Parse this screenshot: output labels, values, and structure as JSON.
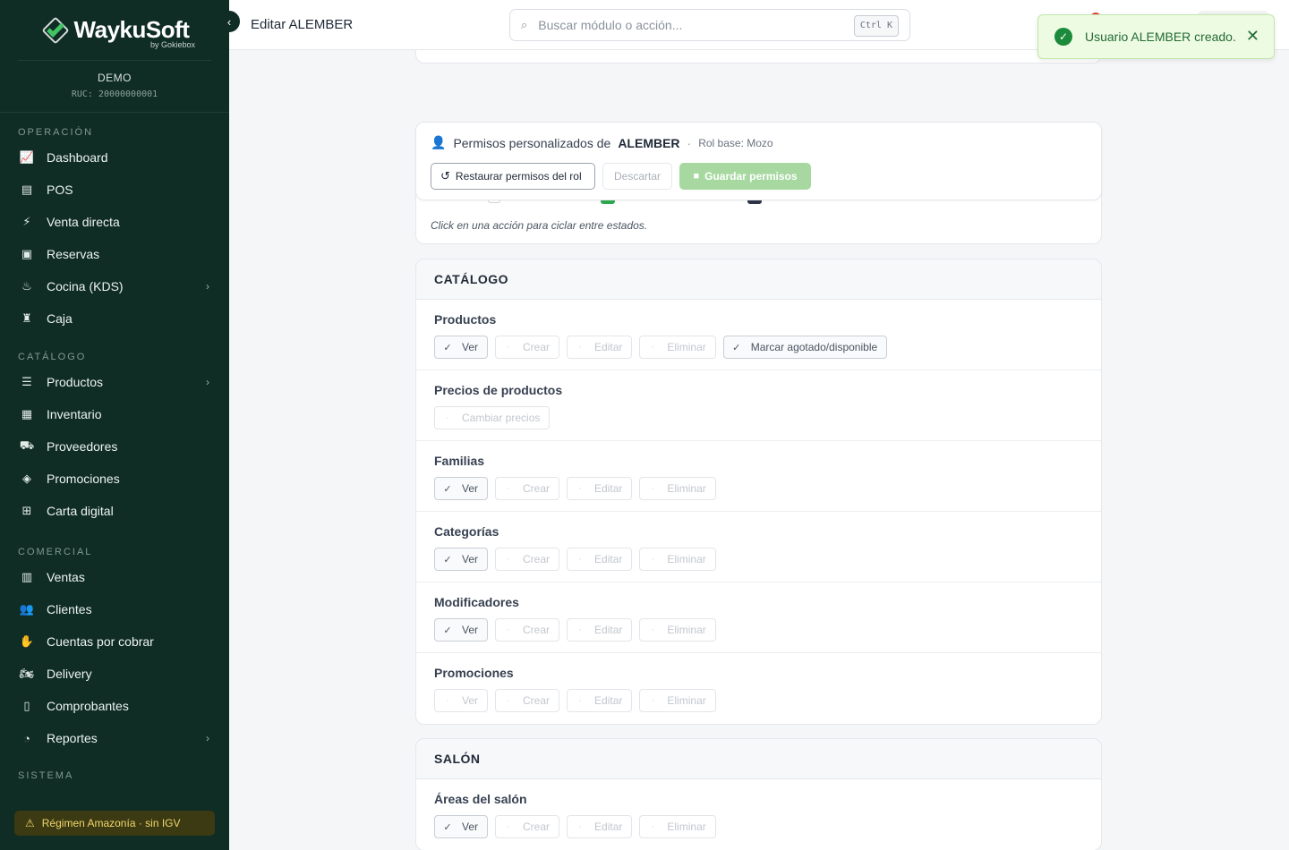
{
  "brand": {
    "name": "WaykuSoft",
    "sub": "by Gokiebox"
  },
  "company": {
    "name": "DEMO",
    "ruc": "RUC: 20000000001"
  },
  "sidebar": {
    "sections": [
      {
        "label": "OPERACIÓN",
        "items": [
          {
            "label": "Dashboard",
            "icon": "chart-line-icon",
            "glyph": "📈"
          },
          {
            "label": "POS",
            "icon": "register-icon",
            "glyph": "▤"
          },
          {
            "label": "Venta directa",
            "icon": "bolt-icon",
            "glyph": "⚡"
          },
          {
            "label": "Reservas",
            "icon": "calendar-check-icon",
            "glyph": "▣"
          },
          {
            "label": "Cocina (KDS)",
            "icon": "kitchen-icon",
            "glyph": "♨",
            "chevron": true
          },
          {
            "label": "Caja",
            "icon": "money-bag-icon",
            "glyph": "♜"
          }
        ]
      },
      {
        "label": "CATÁLOGO",
        "items": [
          {
            "label": "Productos",
            "icon": "burger-icon",
            "glyph": "☰",
            "chevron": true
          },
          {
            "label": "Inventario",
            "icon": "boxes-icon",
            "glyph": "▦"
          },
          {
            "label": "Proveedores",
            "icon": "truck-icon",
            "glyph": "⛟"
          },
          {
            "label": "Promociones",
            "icon": "tags-icon",
            "glyph": "◈"
          },
          {
            "label": "Carta digital",
            "icon": "qr-code-icon",
            "glyph": "⊞"
          }
        ]
      },
      {
        "label": "COMERCIAL",
        "items": [
          {
            "label": "Ventas",
            "icon": "receipt-icon",
            "glyph": "▥"
          },
          {
            "label": "Clientes",
            "icon": "users-icon",
            "glyph": "👥"
          },
          {
            "label": "Cuentas por cobrar",
            "icon": "hand-coin-icon",
            "glyph": "✋"
          },
          {
            "label": "Delivery",
            "icon": "motorcycle-icon",
            "glyph": "🏍"
          },
          {
            "label": "Comprobantes",
            "icon": "file-icon",
            "glyph": "▯"
          },
          {
            "label": "Reportes",
            "icon": "pie-chart-icon",
            "glyph": "◔",
            "chevron": true
          }
        ]
      },
      {
        "label": "SISTEMA",
        "items": []
      }
    ],
    "regime": "Régimen Amazonía · sin IGV"
  },
  "topbar": {
    "title": "Editar ALEMBER",
    "search_placeholder": "Buscar módulo o acción...",
    "shortcut": "Ctrl K"
  },
  "toast": {
    "message": "Usuario ALEMBER creado.",
    "close": "✕"
  },
  "permissions": {
    "title_prefix": "Permisos personalizados de",
    "user": "ALEMBER",
    "role": "Rol base: Mozo",
    "restore_label": "Restaurar permisos del rol",
    "discard_label": "Descartar",
    "save_label": "Guardar permisos",
    "hint": "Click en una acción para ciclar entre estados."
  },
  "sections": [
    {
      "title": "CATÁLOGO",
      "rows": [
        {
          "name": "Productos",
          "actions": [
            {
              "label": "Ver",
              "on": true
            },
            {
              "label": "Crear",
              "on": false
            },
            {
              "label": "Editar",
              "on": false
            },
            {
              "label": "Eliminar",
              "on": false
            },
            {
              "label": "Marcar agotado/disponible",
              "on": true
            }
          ]
        },
        {
          "name": "Precios de productos",
          "actions": [
            {
              "label": "Cambiar precios",
              "on": false
            }
          ]
        },
        {
          "name": "Familias",
          "actions": [
            {
              "label": "Ver",
              "on": true
            },
            {
              "label": "Crear",
              "on": false
            },
            {
              "label": "Editar",
              "on": false
            },
            {
              "label": "Eliminar",
              "on": false
            }
          ]
        },
        {
          "name": "Categorías",
          "actions": [
            {
              "label": "Ver",
              "on": true
            },
            {
              "label": "Crear",
              "on": false
            },
            {
              "label": "Editar",
              "on": false
            },
            {
              "label": "Eliminar",
              "on": false
            }
          ]
        },
        {
          "name": "Modificadores",
          "actions": [
            {
              "label": "Ver",
              "on": true
            },
            {
              "label": "Crear",
              "on": false
            },
            {
              "label": "Editar",
              "on": false
            },
            {
              "label": "Eliminar",
              "on": false
            }
          ]
        },
        {
          "name": "Promociones",
          "actions": [
            {
              "label": "Ver",
              "on": false
            },
            {
              "label": "Crear",
              "on": false
            },
            {
              "label": "Editar",
              "on": false
            },
            {
              "label": "Eliminar",
              "on": false
            }
          ]
        }
      ]
    },
    {
      "title": "SALÓN",
      "rows": [
        {
          "name": "Áreas del salón",
          "actions": [
            {
              "label": "Ver",
              "on": true
            },
            {
              "label": "Crear",
              "on": false
            },
            {
              "label": "Editar",
              "on": false
            },
            {
              "label": "Eliminar",
              "on": false
            }
          ]
        }
      ]
    }
  ],
  "colors": {
    "sidebar": "#0f2c25",
    "accent": "#41c463",
    "toast_bg": "#eefbe3",
    "save_btn": "#a6d8a0"
  }
}
